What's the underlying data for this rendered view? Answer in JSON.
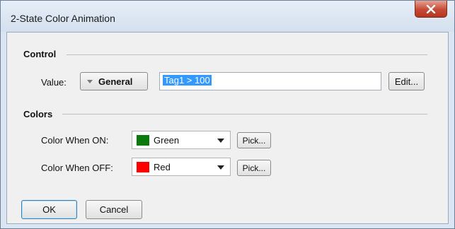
{
  "window": {
    "title": "2-State Color Animation"
  },
  "colors": {
    "green": "#0a7a0a",
    "red": "#ff0000",
    "selection": "#3399ff"
  },
  "control_group": {
    "heading": "Control",
    "value_label": "Value:",
    "mode_button": "General",
    "expression_value": "Tag1 > 100",
    "edit_button": "Edit..."
  },
  "colors_group": {
    "heading": "Colors",
    "on_label": "Color When ON:",
    "on_value": "Green",
    "off_label": "Color When OFF:",
    "off_value": "Red",
    "pick_label": "Pick..."
  },
  "footer": {
    "ok": "OK",
    "cancel": "Cancel"
  }
}
